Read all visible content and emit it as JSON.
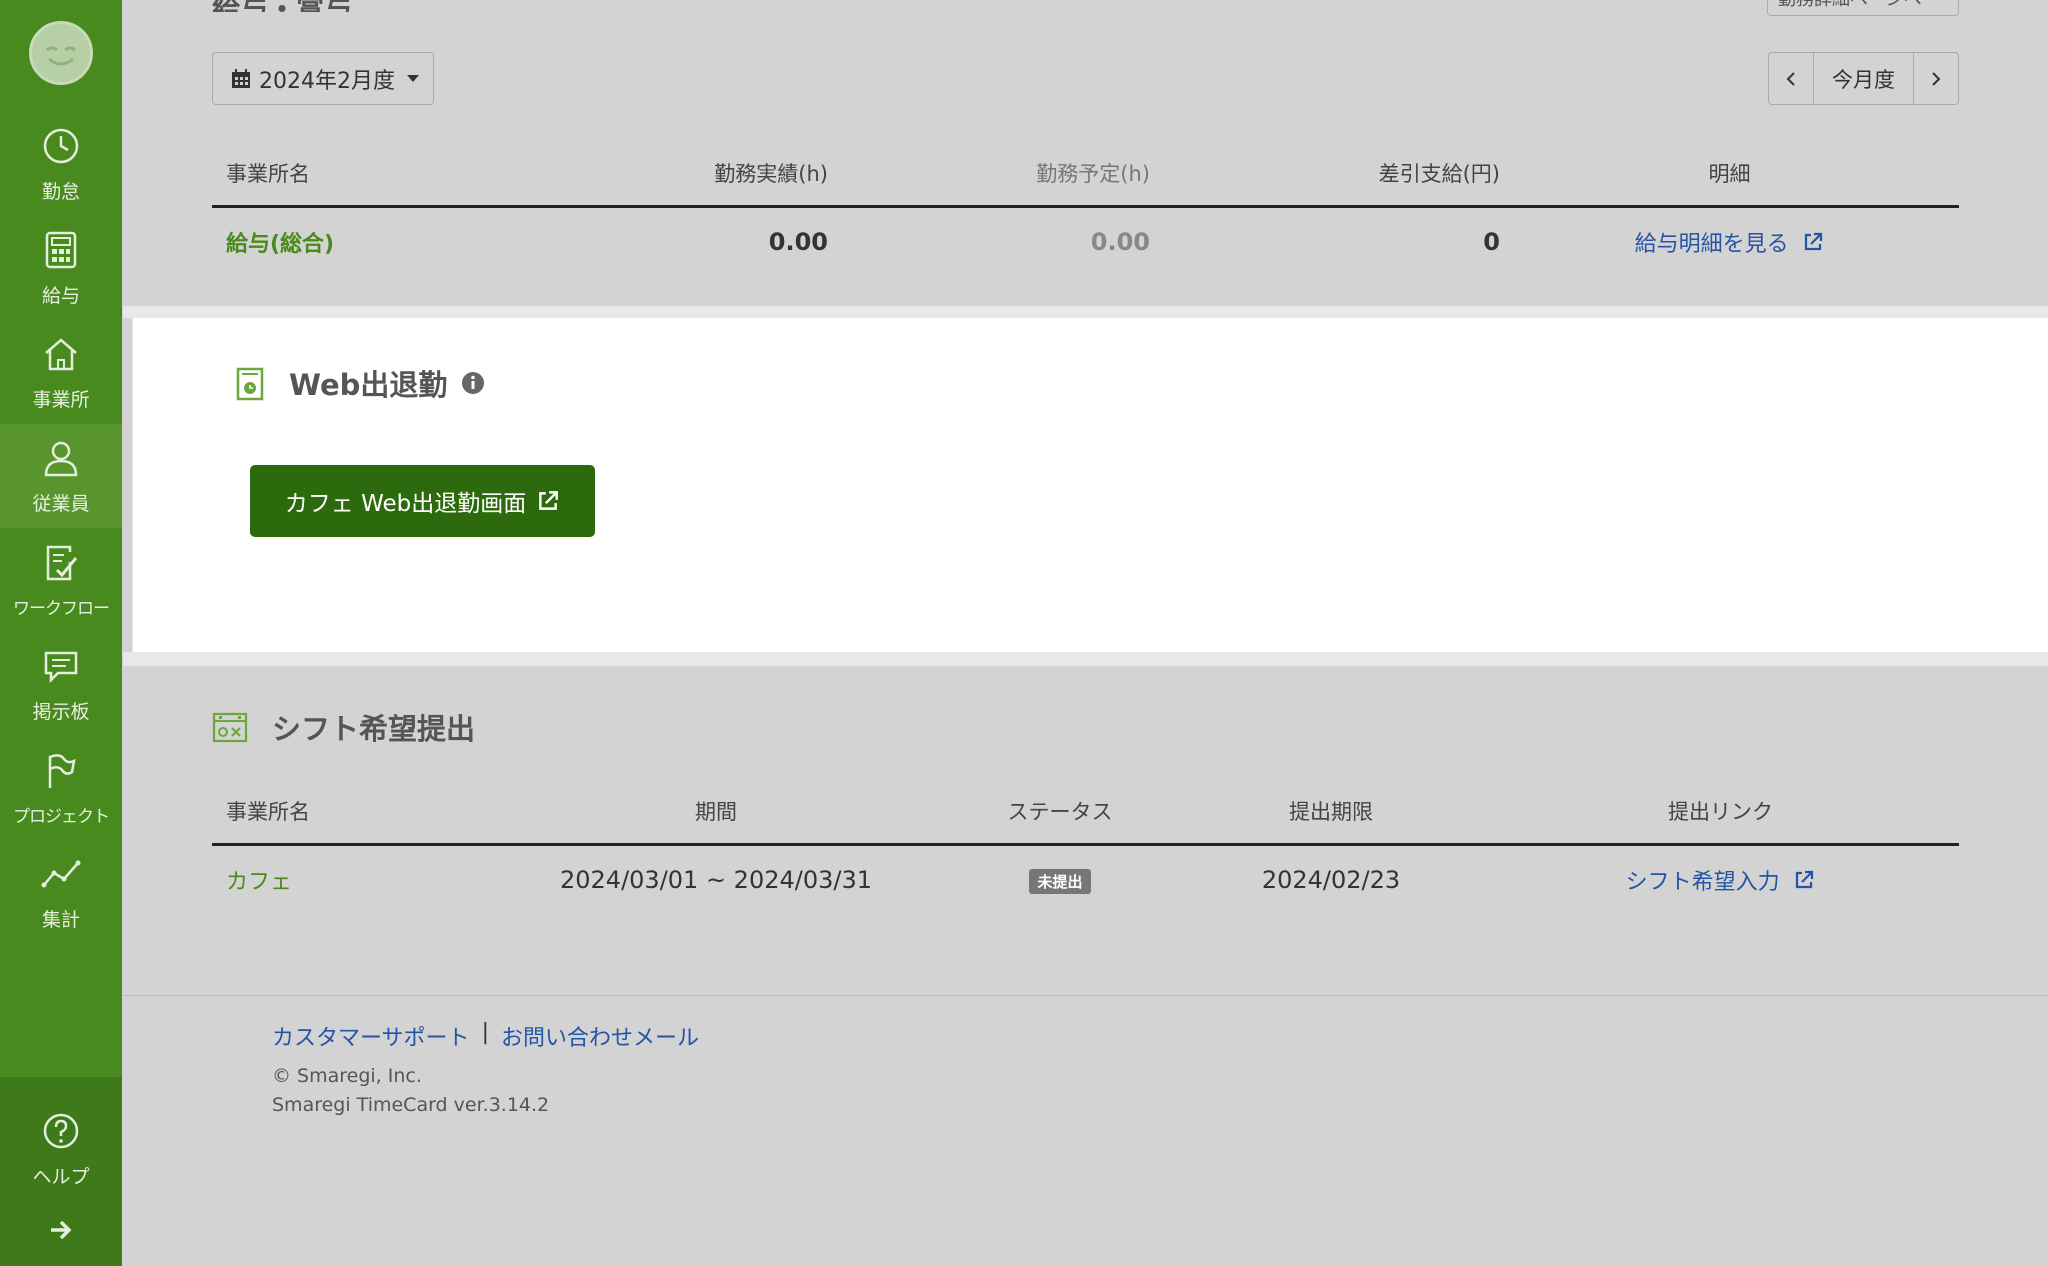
{
  "sidebar": {
    "items": [
      {
        "label": "勤怠",
        "icon": "clock-icon"
      },
      {
        "label": "給与",
        "icon": "calculator-icon"
      },
      {
        "label": "事業所",
        "icon": "home-icon"
      },
      {
        "label": "従業員",
        "icon": "person-icon"
      },
      {
        "label": "ワークフロー",
        "icon": "checklist-icon"
      },
      {
        "label": "掲示板",
        "icon": "chat-icon"
      },
      {
        "label": "プロジェクト",
        "icon": "flag-icon"
      },
      {
        "label": "集計",
        "icon": "line-chart-icon"
      }
    ],
    "active_index": 3,
    "help_label": "ヘルプ"
  },
  "top": {
    "partial_title": "給与・賞与",
    "partial_button": "勤務詳細ページへ"
  },
  "payroll": {
    "month_label": "2024年2月度",
    "pager_current": "今月度",
    "headers": [
      "事業所名",
      "勤務実績(h)",
      "勤務予定(h)",
      "差引支給(円)",
      "明細"
    ],
    "row": {
      "name": "給与(総合)",
      "actual": "0.00",
      "planned": "0.00",
      "net": "0",
      "detail_link": "給与明細を見る"
    }
  },
  "web_clock": {
    "title": "Web出退勤",
    "button_label": "カフェ Web出退勤画面"
  },
  "shift": {
    "title": "シフト希望提出",
    "headers": [
      "事業所名",
      "期間",
      "ステータス",
      "提出期限",
      "提出リンク"
    ],
    "row": {
      "name": "カフェ",
      "period": "2024/03/01 ~ 2024/03/31",
      "status": "未提出",
      "deadline": "2024/02/23",
      "link": "シフト希望入力"
    }
  },
  "footer": {
    "support": "カスタマーサポート",
    "separator": "|",
    "contact": "お問い合わせメール",
    "copyright": "© Smaregi, Inc.",
    "version": "Smaregi TimeCard ver.3.14.2"
  },
  "colors": {
    "sidebar": "#498a1f",
    "sidebar_active": "#58962d",
    "primary_button": "#2d6a0d",
    "link": "#2455a4",
    "green_text": "#4a8a1c"
  }
}
